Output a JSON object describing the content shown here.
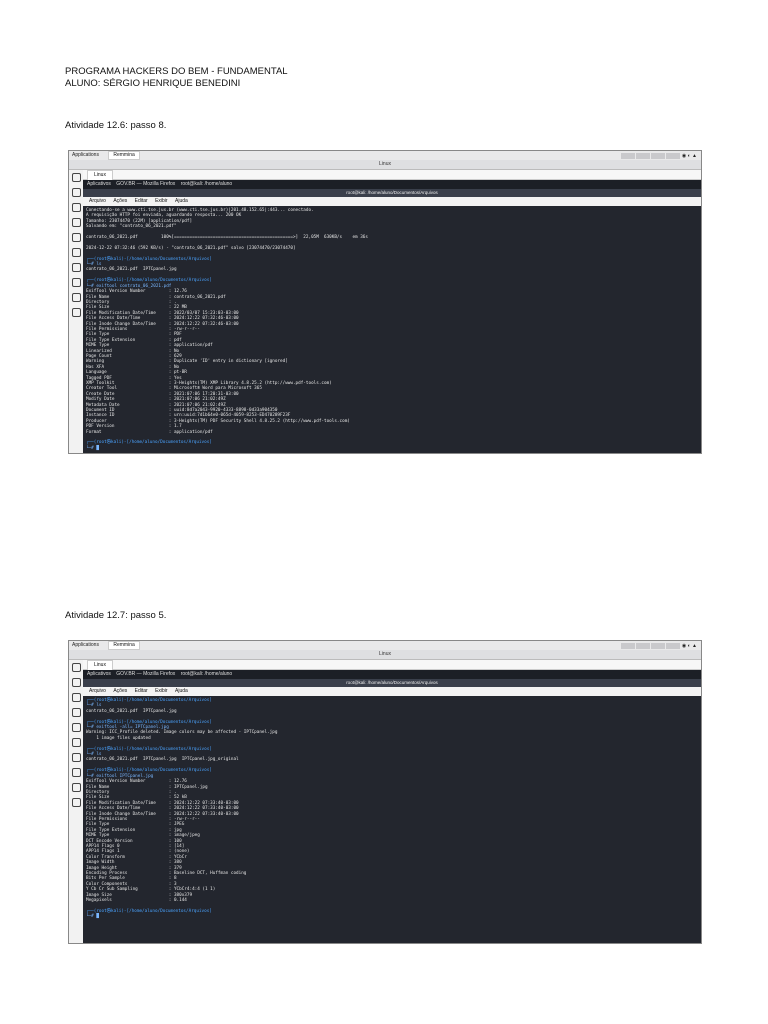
{
  "header": {
    "line1": "PROGRAMA HACKERS DO BEM - FUNDAMENTAL",
    "line2": "ALUNO: SÉRGIO HENRIQUE BENEDINI"
  },
  "activity1": {
    "label": "Atividade 12.6: passo 8.",
    "vbox_tab1": "Applications",
    "vbox_tab2": "Remmina",
    "window_title": "Linux",
    "tab_label": "Linux",
    "kali_apps": "Aplicativos",
    "kali_win1": "GOV.BR — Mozilla Firefox",
    "kali_win2": "root@kali: /home/aluno",
    "term_title": "root@kali: /home/aluno/Documentos/Arquivos",
    "menu": [
      "Arquivo",
      "Ações",
      "Editar",
      "Exibir",
      "Ajuda"
    ],
    "lines": [
      "Conectando-se a www.cti.tse.jus.br (www.cti.tse.jus.br)|201.48.152.65|:443... conectado.",
      "A requisição HTTP foi enviada, aguardando resposta... 200 OK",
      "Tamanho: 23074470 (22M) [application/pdf]",
      "Salvando em: \"contrato_06_2021.pdf\"",
      "",
      "contrato_06_2021.pdf         100%[==============================================>]  22,05M  630KB/s    em 36s",
      "",
      "2024-12-22 07:32:46 (592 KB/s) - \"contrato_06_2021.pdf\" salvo [23074470/23074470]",
      "",
      "┌──(root㉿kali)-[/home/aluno/Documentos/Arquivos]",
      "└─# ls",
      "contrato_06_2021.pdf  IPTCpanel.jpg",
      "",
      "┌──(root㉿kali)-[/home/aluno/Documentos/Arquivos]",
      "└─# exiftool contrato_06_2021.pdf",
      "ExifTool Version Number         : 12.76",
      "File Name                       : contrato_06_2021.pdf",
      "Directory                       : .",
      "File Size                       : 22 MB",
      "File Modification Date/Time     : 2022/03/07 15:23:03-03:00",
      "File Access Date/Time           : 2024:12:22 07:32:46-03:00",
      "File Inode Change Date/Time     : 2024:12:22 07:32:46-03:00",
      "File Permissions                : -rw-r--r--",
      "File Type                       : PDF",
      "File Type Extension             : pdf",
      "MIME Type                       : application/pdf",
      "Linearized                      : No",
      "Page Count                      : 629",
      "Warning                         : Duplicate 'ID' entry in dictionary [ignored]",
      "Has XFA                         : No",
      "Language                        : pt-BR",
      "Tagged PDF                      : Yes",
      "XMP Toolkit                     : 3-Heights(TM) XMP Library 4.8.25.2 (http://www.pdf-tools.com)",
      "Creator Tool                    : Microsoft® Word para Microsoft 365",
      "Create Date                     : 2021:07:06 17:20:31-03:00",
      "Modify Date                     : 2021:07:06 21:02:49Z",
      "Metadata Date                   : 2021:07:06 21:02:49Z",
      "Document ID                     : uuid:8d7a2043-9920-4333-8898-0d33a904350",
      "Instance ID                     : urn:uuid:7d1b64e0-065d-4059-8253-ED470289F23F",
      "Producer                        : 3-Heights(TM) PDF Security Shell 4.8.25.2 (http://www.pdf-tools.com)",
      "PDF Version                     : 1.7",
      "Format                          : application/pdf",
      "",
      "┌──(root㉿kali)-[/home/aluno/Documentos/Arquivos]",
      "└─# █"
    ]
  },
  "activity2": {
    "label": "Atividade 12.7: passo 5.",
    "vbox_tab1": "Applications",
    "vbox_tab2": "Remmina",
    "window_title": "Linux",
    "tab_label": "Linux",
    "kali_apps": "Aplicativos",
    "kali_win1": "GOV.BR — Mozilla Firefox",
    "kali_win2": "root@kali: /home/aluno",
    "term_title": "root@kali: /home/aluno/Documentos/Arquivos",
    "menu": [
      "Arquivo",
      "Ações",
      "Editar",
      "Exibir",
      "Ajuda"
    ],
    "lines": [
      "┌──(root㉿kali)-[/home/aluno/Documentos/Arquivos]",
      "└─# ls",
      "contrato_06_2021.pdf  IPTCpanel.jpg",
      "",
      "┌──(root㉿kali)-[/home/aluno/Documentos/Arquivos]",
      "└─# exiftool -all= IPTCpanel.jpg",
      "Warning: ICC_Profile deleted. Image colors may be affected - IPTCpanel.jpg",
      "    1 image files updated",
      "",
      "┌──(root㉿kali)-[/home/aluno/Documentos/Arquivos]",
      "└─# ls",
      "contrato_06_2021.pdf  IPTCpanel.jpg  IPTCpanel.jpg_original",
      "",
      "┌──(root㉿kali)-[/home/aluno/Documentos/Arquivos]",
      "└─# exiftool IPTCpanel.jpg",
      "ExifTool Version Number         : 12.76",
      "File Name                       : IPTCpanel.jpg",
      "Directory                       : .",
      "File Size                       : 52 kB",
      "File Modification Date/Time     : 2024:12:22 07:33:40-03:00",
      "File Access Date/Time           : 2024:12:22 07:33:40-03:00",
      "File Inode Change Date/Time     : 2024:12:22 07:33:40-03:00",
      "File Permissions                : -rw-r--r--",
      "File Type                       : JPEG",
      "File Type Extension             : jpg",
      "MIME Type                       : image/jpeg",
      "DCT Encode Version              : 100",
      "APP14 Flags 0                   : [14]",
      "APP14 Flags 1                   : (none)",
      "Color Transform                 : YCbCr",
      "Image Width                     : 380",
      "Image Height                    : 379",
      "Encoding Process                : Baseline DCT, Huffman coding",
      "Bits Per Sample                 : 8",
      "Color Components                : 3",
      "Y Cb Cr Sub Sampling            : YCbCr4:4:4 (1 1)",
      "Image Size                      : 380x379",
      "Megapixels                      : 0.144",
      "",
      "┌──(root㉿kali)-[/home/aluno/Documentos/Arquivos]",
      "└─# █"
    ]
  }
}
